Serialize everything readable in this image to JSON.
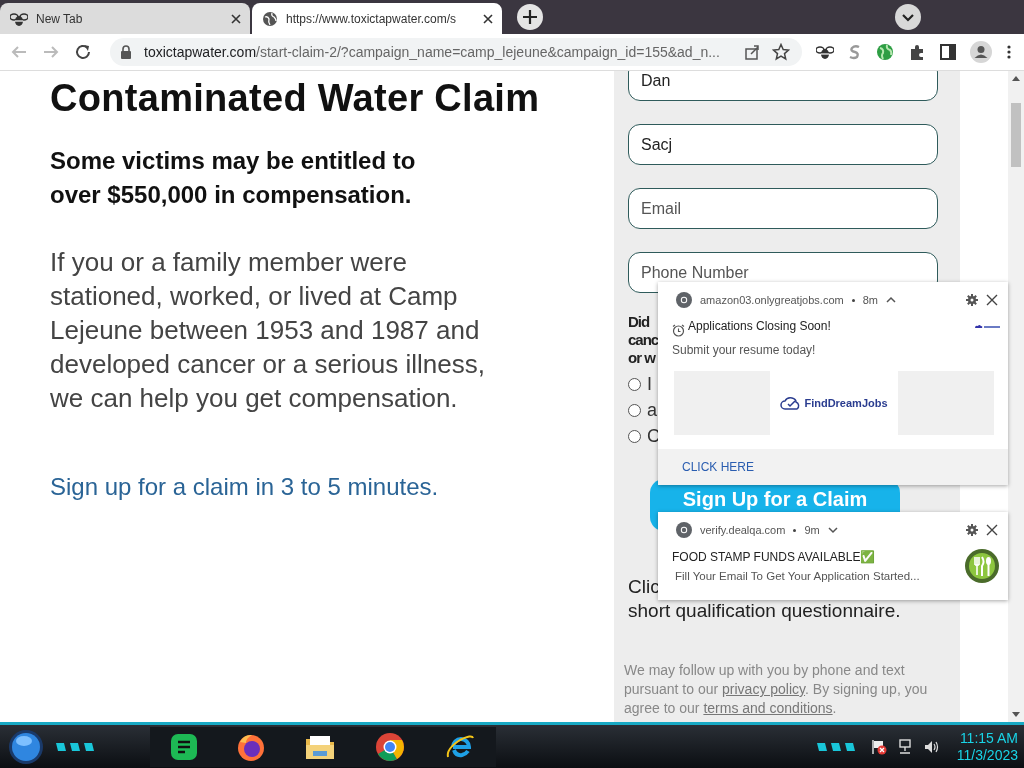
{
  "tabs": [
    {
      "title": "New Tab",
      "selected": false
    },
    {
      "title": "https://www.toxictapwater.com/s",
      "selected": true
    }
  ],
  "address_bar": {
    "domain": "toxictapwater.com",
    "path": "/start-claim-2/?campaign_name=camp_lejeune&campaign_id=155&ad_n..."
  },
  "page": {
    "heading": "Contaminated Water Claim",
    "subheading": "Some victims may be entitled to over $550,000 in compensation.",
    "body": "If you or a family member were stationed, worked, or lived at Camp Lejeune between 1953 and 1987 and developed cancer or a serious illness, we can help you get compensation.",
    "link": "Sign up for a claim in 3 to 5 minutes."
  },
  "form": {
    "fields": [
      {
        "value": "Dan"
      },
      {
        "value": "Sacj"
      },
      {
        "placeholder": "Email"
      },
      {
        "placeholder": "Phone Number"
      }
    ],
    "question_lines": [
      "Did",
      "canc",
      "or w"
    ],
    "options": [
      {
        "label": "I",
        "selected": false
      },
      {
        "label": "a",
        "selected": false
      },
      {
        "label": "C",
        "selected": false
      }
    ],
    "submit": "Sign Up for a Claim",
    "note_lines": [
      "Clic",
      "short qualification questionnaire."
    ],
    "disclaimer": [
      {
        "kind": "text",
        "text": "We may follow up with you by phone and text pursuant to our "
      },
      {
        "kind": "link",
        "text": "privacy policy"
      },
      {
        "kind": "text",
        "text": ". By signing up, you agree to our "
      },
      {
        "kind": "link",
        "text": "terms and conditions"
      },
      {
        "kind": "text",
        "text": "."
      }
    ]
  },
  "notifications": [
    {
      "kind": "image",
      "site": "amazon03.onlygreatjobs.com",
      "age": "8m",
      "expanded": true,
      "title": "Applications Closing Soon!",
      "body": "Submit your resume today!",
      "image_text": "FindDreamJobs",
      "action": "CLICK HERE"
    },
    {
      "kind": "icon",
      "site": "verify.dealqa.com",
      "age": "9m",
      "expanded": false,
      "title": "FOOD STAMP FUNDS AVAILABLE✅",
      "body": "Fill Your Email To Get Your Application Started..."
    }
  ],
  "clock": {
    "time": "11:15 AM",
    "date": "11/3/2023"
  }
}
